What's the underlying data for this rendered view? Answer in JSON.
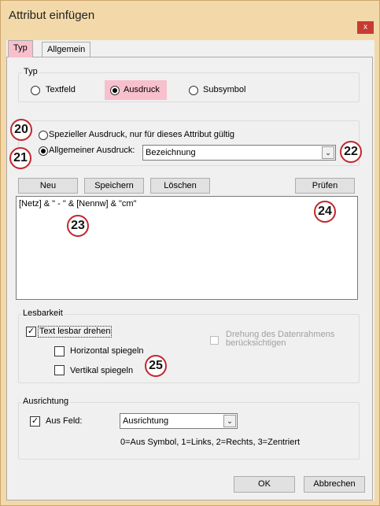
{
  "window": {
    "title": "Attribut einfügen",
    "close_glyph": "x"
  },
  "tabs": [
    {
      "label": "Typ",
      "active": true
    },
    {
      "label": "Allgemein",
      "active": false
    }
  ],
  "typ_group": {
    "label": "Typ",
    "options": [
      {
        "label": "Textfeld",
        "selected": false
      },
      {
        "label": "Ausdruck",
        "selected": true
      },
      {
        "label": "Subsymbol",
        "selected": false
      }
    ]
  },
  "expression": {
    "special_label": "Spezieller Ausdruck, nur für dieses Attribut gültig",
    "special_selected": false,
    "general_label": "Allgemeiner Ausdruck:",
    "general_selected": true,
    "general_value": "Bezeichnung"
  },
  "toolbar": {
    "new_label": "Neu",
    "save_label": "Speichern",
    "delete_label": "Löschen",
    "check_label": "Prüfen"
  },
  "expression_text": "[Netz] & \" - \" & [Nennw] & \"cm\"",
  "lesbarkeit": {
    "label": "Lesbarkeit",
    "rotate_label": "Text lesbar drehen",
    "rotate_checked": true,
    "mirror_h_label": "Horizontal spiegeln",
    "mirror_h_checked": false,
    "mirror_v_label": "Vertikal spiegeln",
    "mirror_v_checked": false,
    "frame_label_line1": "Drehung des Datenrahmens",
    "frame_label_line2": "berücksichtigen",
    "frame_checked": false
  },
  "ausrichtung": {
    "label": "Ausrichtung",
    "from_field_label": "Aus Feld:",
    "from_field_checked": true,
    "field_value": "Ausrichtung",
    "hint": "0=Aus Symbol, 1=Links, 2=Rechts, 3=Zentriert"
  },
  "footer": {
    "ok_label": "OK",
    "cancel_label": "Abbrechen"
  },
  "callouts": {
    "c20": "20",
    "c21": "21",
    "c22": "22",
    "c23": "23",
    "c24": "24",
    "c25": "25"
  },
  "colors": {
    "titlebar": "#f3d9a9",
    "close": "#c73b35",
    "highlight": "#f7c0cc",
    "callout_border": "#c1272d"
  },
  "glyphs": {
    "check": "✓",
    "dropdown": "⌄"
  }
}
